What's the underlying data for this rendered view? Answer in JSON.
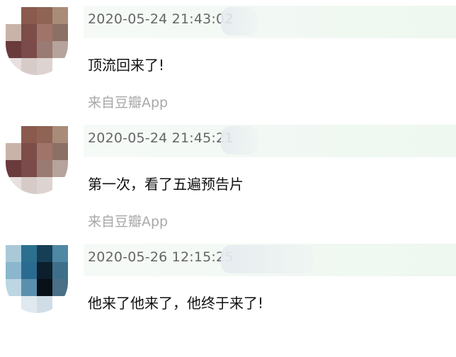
{
  "comments": [
    {
      "timestamp": "2020-05-24 21:43:02",
      "content": "顶流回来了!",
      "source": "来自豆瓣App",
      "avatar_colors": [
        "#ffffff",
        "#8a5a4f",
        "#8f6455",
        "#a88b78",
        "#c9b3a8",
        "#7d4d48",
        "#a07469",
        "#8c6f65",
        "#6b3a3c",
        "#7a4b4a",
        "#9a7b73",
        "#b5a39c",
        "#e8e0de",
        "#d7cbc8",
        "#ddd3d0",
        "#ffffff"
      ]
    },
    {
      "timestamp": "2020-05-24 21:45:21",
      "content": "第一次，看了五遍预告片",
      "source": "来自豆瓣App",
      "avatar_colors": [
        "#ffffff",
        "#8a5a4f",
        "#8f6455",
        "#a88b78",
        "#c9b3a8",
        "#7d4d48",
        "#a07469",
        "#8c6f65",
        "#6b3a3c",
        "#7a4b4a",
        "#9a7b73",
        "#b5a39c",
        "#e8e0de",
        "#d7cbc8",
        "#ddd3d0",
        "#ffffff"
      ]
    },
    {
      "timestamp": "2020-05-26 12:15:25",
      "content": "他来了他来了，他终于来了!",
      "source": "",
      "avatar_colors": [
        "#a9c9d8",
        "#2d6f8f",
        "#163f56",
        "#4e88a3",
        "#8ab7cd",
        "#2a6b92",
        "#0d1f2c",
        "#3e6f8a",
        "#bcd6e3",
        "#5b8fae",
        "#081018",
        "#4a6f86",
        "#ffffff",
        "#dfe9ef",
        "#d0dde6",
        "#ffffff"
      ]
    }
  ]
}
